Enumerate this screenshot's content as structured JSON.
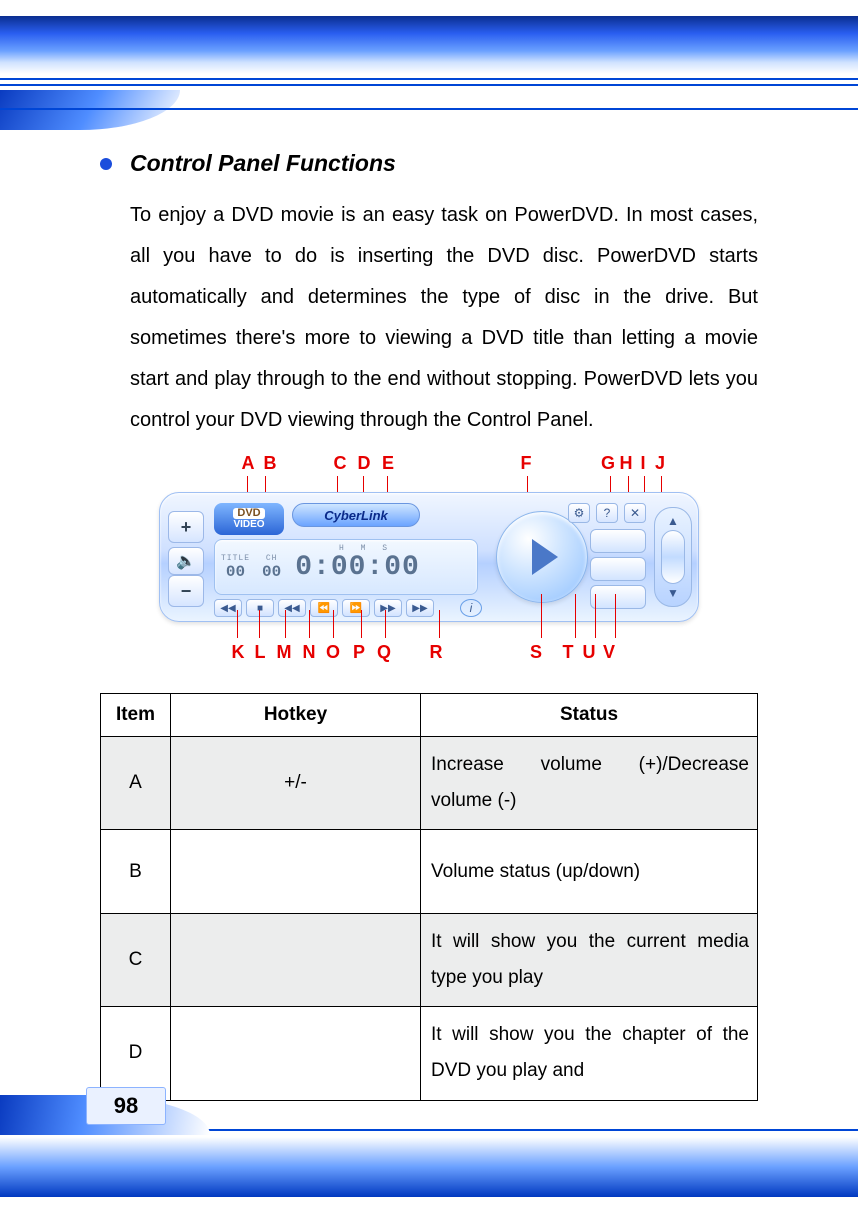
{
  "header": {
    "section_title": "Control Panel Functions",
    "paragraph": "To enjoy a DVD movie is an easy task on PowerDVD.  In most cases, all you have to do is inserting the DVD disc.  PowerDVD starts automatically and determines the type of disc in the drive. But sometimes there's more to viewing a DVD title than letting a movie start and play through to the end without stopping. PowerDVD lets you control your DVD viewing through the Control Panel."
  },
  "figure": {
    "top_labels": {
      "A": "A",
      "B": "B",
      "C": "C",
      "D": "D",
      "E": "E",
      "F": "F",
      "G": "G",
      "H": "H",
      "I": "I",
      "J": "J"
    },
    "bottom_labels": {
      "K": "K",
      "L": "L",
      "M": "M",
      "N": "N",
      "O": "O",
      "P": "P",
      "Q": "Q",
      "R": "R",
      "S": "S",
      "T": "T",
      "U": "U",
      "V": "V"
    },
    "panel": {
      "vol_plus": "+",
      "vol_minus": "−",
      "mute": "🔈",
      "dvd_line1": "DVD",
      "dvd_line2": "VIDEO",
      "brand": "CyberLink",
      "title_lbl": "TITLE",
      "ch_lbl": "CH",
      "title_val": "00",
      "ch_val": "00",
      "hms": "H  M  S",
      "time": "0:00:00",
      "transport": {
        "k": "◀◀",
        "l": "■",
        "m": "◀◀",
        "n": "⏪",
        "o": "⏩",
        "p": "▶▶",
        "q": "▶▶"
      },
      "info": "i",
      "conf": "⚙",
      "help": "?",
      "close": "✕",
      "scroll_up": "▲",
      "scroll_dn": "▼"
    }
  },
  "table": {
    "headers": {
      "item": "Item",
      "hotkey": "Hotkey",
      "status": "Status"
    },
    "rows": [
      {
        "item": "A",
        "hotkey": "+/-",
        "status": "Increase volume (+)/Decrease volume (-)"
      },
      {
        "item": "B",
        "hotkey": "",
        "status": "Volume status (up/down)"
      },
      {
        "item": "C",
        "hotkey": "",
        "status": "It will show you the current media type you play"
      },
      {
        "item": "D",
        "hotkey": "",
        "status": "It will show you the chapter of the DVD you play and"
      }
    ]
  },
  "page_number": "98"
}
